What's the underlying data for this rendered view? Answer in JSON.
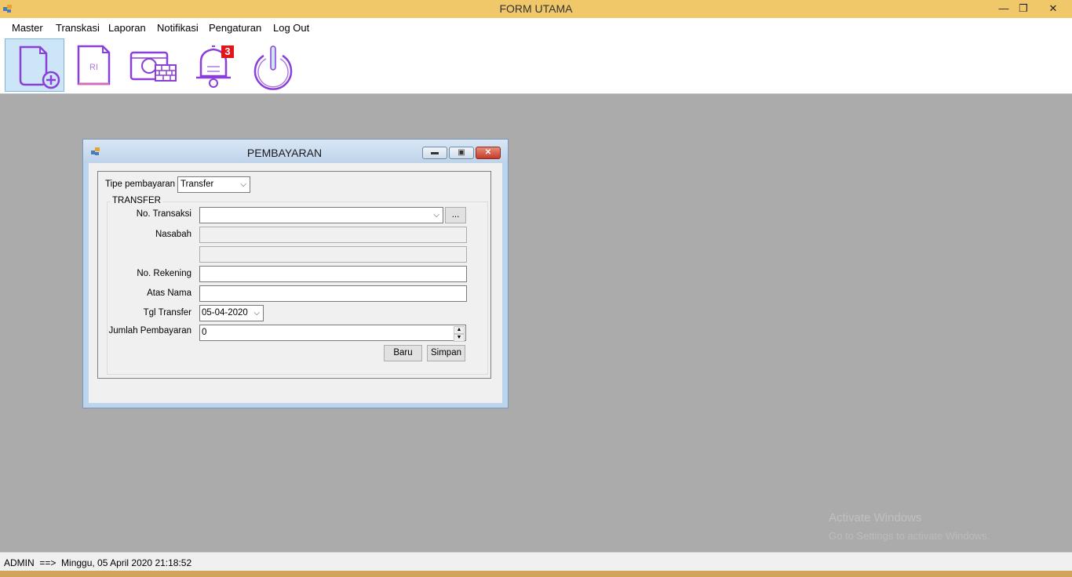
{
  "window": {
    "title": "FORM UTAMA"
  },
  "menu": [
    "Master",
    "Transkasi",
    "Laporan",
    "Notifikasi",
    "Pengaturan",
    "Log Out"
  ],
  "toolbar": {
    "buttons": [
      {
        "icon": "new-document-icon"
      },
      {
        "icon": "document-icon"
      },
      {
        "icon": "money-icon"
      },
      {
        "icon": "notification-bell-icon",
        "badge": "3"
      },
      {
        "icon": "power-icon"
      }
    ]
  },
  "child": {
    "title": "PEMBAYARAN",
    "tipe_label": "Tipe pembayaran",
    "tipe_value": "Transfer",
    "group_title": "TRANSFER",
    "no_transaksi_label": "No. Transaksi",
    "no_transaksi_value": "",
    "browse_label": "...",
    "nasabah_label": "Nasabah",
    "nasabah_value": "",
    "nasabah2_value": "",
    "no_rekening_label": "No. Rekening",
    "no_rekening_value": "",
    "atas_nama_label": "Atas Nama",
    "atas_nama_value": "",
    "tgl_transfer_label": "Tgl Transfer",
    "tgl_transfer_value": "05-04-2020",
    "jumlah_label": "Jumlah Pembayaran",
    "jumlah_value": "0",
    "baru_label": "Baru",
    "simpan_label": "Simpan"
  },
  "status": {
    "text": "ADMIN  ==>  Minggu, 05 April 2020 21:18:52"
  },
  "watermark": {
    "line1": "Activate Windows",
    "line2": "Go to Settings to activate Windows."
  },
  "colors": {
    "titlebar": "#f0c869",
    "accent_purple": "#8a3fd8",
    "mdi_bg": "#ababab"
  }
}
